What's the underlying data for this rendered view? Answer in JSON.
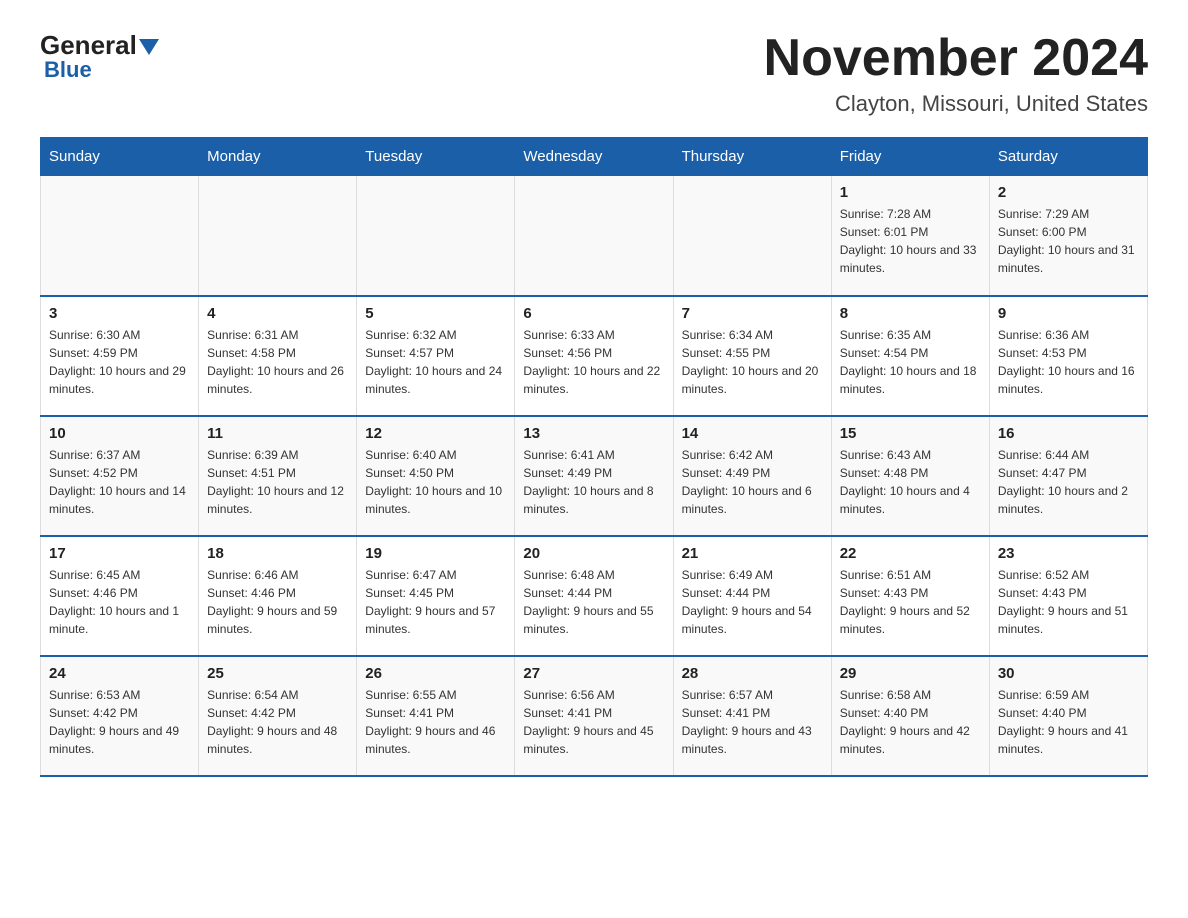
{
  "header": {
    "logo_general": "General",
    "logo_blue": "Blue",
    "title": "November 2024",
    "subtitle": "Clayton, Missouri, United States"
  },
  "calendar": {
    "days_of_week": [
      "Sunday",
      "Monday",
      "Tuesday",
      "Wednesday",
      "Thursday",
      "Friday",
      "Saturday"
    ],
    "weeks": [
      [
        {
          "day": "",
          "info": ""
        },
        {
          "day": "",
          "info": ""
        },
        {
          "day": "",
          "info": ""
        },
        {
          "day": "",
          "info": ""
        },
        {
          "day": "",
          "info": ""
        },
        {
          "day": "1",
          "info": "Sunrise: 7:28 AM\nSunset: 6:01 PM\nDaylight: 10 hours and 33 minutes."
        },
        {
          "day": "2",
          "info": "Sunrise: 7:29 AM\nSunset: 6:00 PM\nDaylight: 10 hours and 31 minutes."
        }
      ],
      [
        {
          "day": "3",
          "info": "Sunrise: 6:30 AM\nSunset: 4:59 PM\nDaylight: 10 hours and 29 minutes."
        },
        {
          "day": "4",
          "info": "Sunrise: 6:31 AM\nSunset: 4:58 PM\nDaylight: 10 hours and 26 minutes."
        },
        {
          "day": "5",
          "info": "Sunrise: 6:32 AM\nSunset: 4:57 PM\nDaylight: 10 hours and 24 minutes."
        },
        {
          "day": "6",
          "info": "Sunrise: 6:33 AM\nSunset: 4:56 PM\nDaylight: 10 hours and 22 minutes."
        },
        {
          "day": "7",
          "info": "Sunrise: 6:34 AM\nSunset: 4:55 PM\nDaylight: 10 hours and 20 minutes."
        },
        {
          "day": "8",
          "info": "Sunrise: 6:35 AM\nSunset: 4:54 PM\nDaylight: 10 hours and 18 minutes."
        },
        {
          "day": "9",
          "info": "Sunrise: 6:36 AM\nSunset: 4:53 PM\nDaylight: 10 hours and 16 minutes."
        }
      ],
      [
        {
          "day": "10",
          "info": "Sunrise: 6:37 AM\nSunset: 4:52 PM\nDaylight: 10 hours and 14 minutes."
        },
        {
          "day": "11",
          "info": "Sunrise: 6:39 AM\nSunset: 4:51 PM\nDaylight: 10 hours and 12 minutes."
        },
        {
          "day": "12",
          "info": "Sunrise: 6:40 AM\nSunset: 4:50 PM\nDaylight: 10 hours and 10 minutes."
        },
        {
          "day": "13",
          "info": "Sunrise: 6:41 AM\nSunset: 4:49 PM\nDaylight: 10 hours and 8 minutes."
        },
        {
          "day": "14",
          "info": "Sunrise: 6:42 AM\nSunset: 4:49 PM\nDaylight: 10 hours and 6 minutes."
        },
        {
          "day": "15",
          "info": "Sunrise: 6:43 AM\nSunset: 4:48 PM\nDaylight: 10 hours and 4 minutes."
        },
        {
          "day": "16",
          "info": "Sunrise: 6:44 AM\nSunset: 4:47 PM\nDaylight: 10 hours and 2 minutes."
        }
      ],
      [
        {
          "day": "17",
          "info": "Sunrise: 6:45 AM\nSunset: 4:46 PM\nDaylight: 10 hours and 1 minute."
        },
        {
          "day": "18",
          "info": "Sunrise: 6:46 AM\nSunset: 4:46 PM\nDaylight: 9 hours and 59 minutes."
        },
        {
          "day": "19",
          "info": "Sunrise: 6:47 AM\nSunset: 4:45 PM\nDaylight: 9 hours and 57 minutes."
        },
        {
          "day": "20",
          "info": "Sunrise: 6:48 AM\nSunset: 4:44 PM\nDaylight: 9 hours and 55 minutes."
        },
        {
          "day": "21",
          "info": "Sunrise: 6:49 AM\nSunset: 4:44 PM\nDaylight: 9 hours and 54 minutes."
        },
        {
          "day": "22",
          "info": "Sunrise: 6:51 AM\nSunset: 4:43 PM\nDaylight: 9 hours and 52 minutes."
        },
        {
          "day": "23",
          "info": "Sunrise: 6:52 AM\nSunset: 4:43 PM\nDaylight: 9 hours and 51 minutes."
        }
      ],
      [
        {
          "day": "24",
          "info": "Sunrise: 6:53 AM\nSunset: 4:42 PM\nDaylight: 9 hours and 49 minutes."
        },
        {
          "day": "25",
          "info": "Sunrise: 6:54 AM\nSunset: 4:42 PM\nDaylight: 9 hours and 48 minutes."
        },
        {
          "day": "26",
          "info": "Sunrise: 6:55 AM\nSunset: 4:41 PM\nDaylight: 9 hours and 46 minutes."
        },
        {
          "day": "27",
          "info": "Sunrise: 6:56 AM\nSunset: 4:41 PM\nDaylight: 9 hours and 45 minutes."
        },
        {
          "day": "28",
          "info": "Sunrise: 6:57 AM\nSunset: 4:41 PM\nDaylight: 9 hours and 43 minutes."
        },
        {
          "day": "29",
          "info": "Sunrise: 6:58 AM\nSunset: 4:40 PM\nDaylight: 9 hours and 42 minutes."
        },
        {
          "day": "30",
          "info": "Sunrise: 6:59 AM\nSunset: 4:40 PM\nDaylight: 9 hours and 41 minutes."
        }
      ]
    ]
  }
}
